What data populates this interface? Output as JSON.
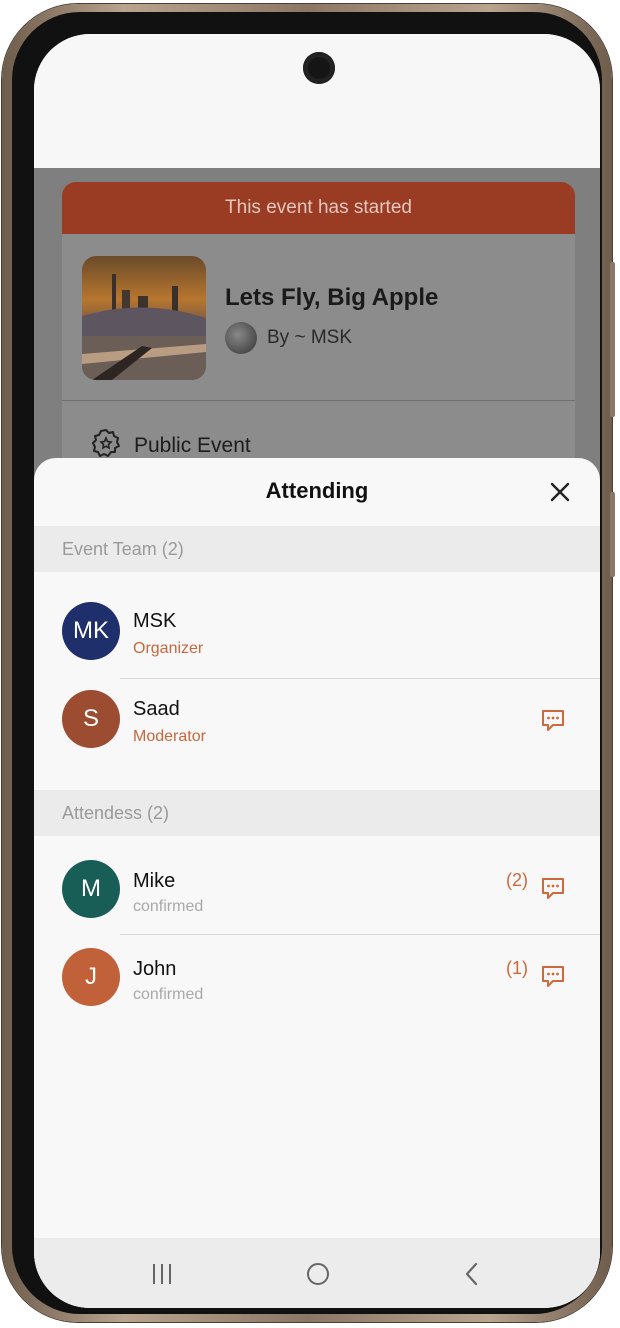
{
  "event": {
    "banner": "This event has started",
    "title": "Lets Fly, Big Apple",
    "by": "By ~ MSK",
    "visibility": "Public Event"
  },
  "sheet": {
    "title": "Attending",
    "team_header": "Event Team (2)",
    "attendees_header": "Attendess (2)"
  },
  "team": [
    {
      "initials": "MK",
      "name": "MSK",
      "role": "Organizer",
      "color": "#1f2f6b"
    },
    {
      "initials": "S",
      "name": "Saad",
      "role": "Moderator",
      "color": "#9c4c31"
    }
  ],
  "attendees": [
    {
      "initials": "M",
      "name": "Mike",
      "status": "confirmed",
      "count": "(2)",
      "color": "#185e57"
    },
    {
      "initials": "J",
      "name": "John",
      "status": "confirmed",
      "count": "(1)",
      "color": "#c1613a"
    }
  ],
  "icons": {
    "close": "close-icon",
    "chat": "chat-bubble-icon",
    "public": "gear-badge-icon",
    "nav_recents": "recents-icon",
    "nav_home": "home-icon",
    "nav_back": "back-icon"
  },
  "colors": {
    "accent": "#c7673c",
    "banner": "#9a3b24"
  }
}
